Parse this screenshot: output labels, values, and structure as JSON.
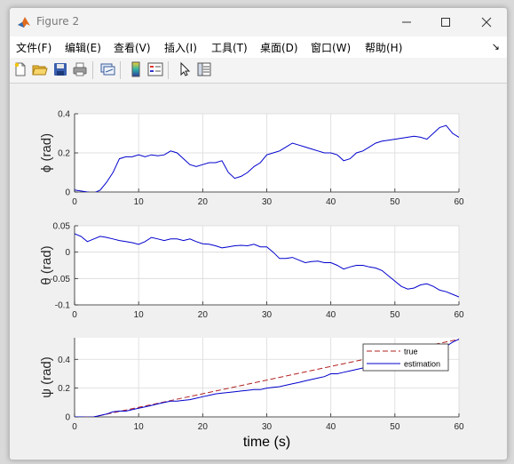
{
  "window": {
    "title": "Figure 2"
  },
  "menu": [
    "文件(F)",
    "编辑(E)",
    "查看(V)",
    "插入(I)",
    "工具(T)",
    "桌面(D)",
    "窗口(W)",
    "帮助(H)"
  ],
  "menu_arrow": "↘",
  "toolbar": [
    "new-figure-icon",
    "open-file-icon",
    "save-icon",
    "print-icon",
    "link-plot-icon",
    "colorbar-icon",
    "legend-icon",
    "pointer-icon",
    "property-inspector-icon"
  ],
  "colors": {
    "axis_line": "#262626",
    "grid": "#d9d9d9",
    "estimation": "#0000cd",
    "true": "#b22222"
  },
  "chart_data": [
    {
      "type": "line",
      "ylabel": "ϕ (rad)",
      "xlim": [
        0,
        60
      ],
      "ylim": [
        0,
        0.4
      ],
      "xticks": [
        "0",
        "10",
        "20",
        "30",
        "40",
        "50",
        "60"
      ],
      "yticks": [
        "0",
        "0.2",
        "0.4"
      ],
      "grid": true,
      "series": [
        {
          "name": "estimation",
          "x": [
            0,
            1,
            2,
            3,
            4,
            5,
            6,
            7,
            8,
            9,
            10,
            11,
            12,
            13,
            14,
            15,
            16,
            17,
            18,
            19,
            20,
            21,
            22,
            23,
            24,
            25,
            26,
            27,
            28,
            29,
            30,
            31,
            32,
            33,
            34,
            35,
            36,
            37,
            38,
            39,
            40,
            41,
            42,
            43,
            44,
            45,
            46,
            47,
            48,
            49,
            50,
            51,
            52,
            53,
            54,
            55,
            56,
            57,
            58,
            59,
            60
          ],
          "values": [
            0.01,
            0.005,
            0.0,
            -0.005,
            0.01,
            0.05,
            0.1,
            0.17,
            0.18,
            0.18,
            0.19,
            0.18,
            0.19,
            0.185,
            0.19,
            0.21,
            0.2,
            0.17,
            0.14,
            0.13,
            0.14,
            0.15,
            0.15,
            0.16,
            0.1,
            0.07,
            0.08,
            0.1,
            0.13,
            0.15,
            0.19,
            0.2,
            0.21,
            0.23,
            0.25,
            0.24,
            0.23,
            0.22,
            0.21,
            0.2,
            0.2,
            0.19,
            0.16,
            0.17,
            0.2,
            0.21,
            0.23,
            0.25,
            0.26,
            0.265,
            0.27,
            0.275,
            0.28,
            0.285,
            0.28,
            0.27,
            0.3,
            0.33,
            0.34,
            0.3,
            0.28
          ]
        }
      ]
    },
    {
      "type": "line",
      "ylabel": "θ (rad)",
      "xlim": [
        0,
        60
      ],
      "ylim": [
        -0.1,
        0.05
      ],
      "xticks": [
        "0",
        "10",
        "20",
        "30",
        "40",
        "50",
        "60"
      ],
      "yticks": [
        "0.05",
        "0",
        "-0.05",
        "-0.1"
      ],
      "grid": true,
      "series": [
        {
          "name": "estimation",
          "x": [
            0,
            1,
            2,
            3,
            4,
            5,
            6,
            7,
            8,
            9,
            10,
            11,
            12,
            13,
            14,
            15,
            16,
            17,
            18,
            19,
            20,
            21,
            22,
            23,
            24,
            25,
            26,
            27,
            28,
            29,
            30,
            31,
            32,
            33,
            34,
            35,
            36,
            37,
            38,
            39,
            40,
            41,
            42,
            43,
            44,
            45,
            46,
            47,
            48,
            49,
            50,
            51,
            52,
            53,
            54,
            55,
            56,
            57,
            58,
            59,
            60
          ],
          "values": [
            0.035,
            0.03,
            0.02,
            0.025,
            0.03,
            0.028,
            0.025,
            0.022,
            0.02,
            0.018,
            0.015,
            0.02,
            0.028,
            0.025,
            0.022,
            0.025,
            0.025,
            0.022,
            0.025,
            0.02,
            0.016,
            0.015,
            0.012,
            0.008,
            0.01,
            0.012,
            0.013,
            0.012,
            0.015,
            0.01,
            0.01,
            0.0,
            -0.012,
            -0.012,
            -0.01,
            -0.015,
            -0.02,
            -0.018,
            -0.017,
            -0.02,
            -0.02,
            -0.025,
            -0.032,
            -0.028,
            -0.025,
            -0.025,
            -0.028,
            -0.03,
            -0.035,
            -0.045,
            -0.055,
            -0.065,
            -0.07,
            -0.068,
            -0.062,
            -0.06,
            -0.065,
            -0.072,
            -0.075,
            -0.08,
            -0.085
          ]
        }
      ]
    },
    {
      "type": "line",
      "ylabel": "ψ (rad)",
      "xlabel": "time (s)",
      "xlim": [
        0,
        60
      ],
      "ylim": [
        0,
        0.55
      ],
      "xticks": [
        "0",
        "10",
        "20",
        "30",
        "40",
        "50",
        "60"
      ],
      "yticks": [
        "0",
        "0.2",
        "0.4"
      ],
      "grid": true,
      "legend": {
        "position": "top-right",
        "entries": [
          "true",
          "estimation"
        ]
      },
      "series": [
        {
          "name": "true",
          "x": [
            0,
            3,
            60
          ],
          "values": [
            0.0,
            0.0,
            0.54
          ]
        },
        {
          "name": "estimation",
          "x": [
            0,
            1,
            2,
            3,
            4,
            5,
            6,
            7,
            8,
            9,
            10,
            11,
            12,
            13,
            14,
            15,
            16,
            17,
            18,
            19,
            20,
            21,
            22,
            23,
            24,
            25,
            26,
            27,
            28,
            29,
            30,
            31,
            32,
            33,
            34,
            35,
            36,
            37,
            38,
            39,
            40,
            41,
            42,
            43,
            44,
            45,
            46,
            47,
            48,
            49,
            50,
            51,
            52,
            53,
            54,
            55,
            56,
            57,
            58,
            59,
            60
          ],
          "values": [
            0.0,
            0.0,
            -0.002,
            0.0,
            0.01,
            0.02,
            0.035,
            0.04,
            0.04,
            0.05,
            0.06,
            0.07,
            0.08,
            0.09,
            0.1,
            0.11,
            0.11,
            0.115,
            0.12,
            0.13,
            0.14,
            0.15,
            0.16,
            0.165,
            0.17,
            0.175,
            0.18,
            0.185,
            0.19,
            0.19,
            0.2,
            0.205,
            0.21,
            0.22,
            0.23,
            0.24,
            0.25,
            0.26,
            0.27,
            0.28,
            0.3,
            0.3,
            0.31,
            0.32,
            0.33,
            0.34,
            0.35,
            0.36,
            0.37,
            0.38,
            0.39,
            0.4,
            0.41,
            0.42,
            0.43,
            0.44,
            0.45,
            0.47,
            0.49,
            0.52,
            0.54
          ]
        }
      ]
    }
  ]
}
